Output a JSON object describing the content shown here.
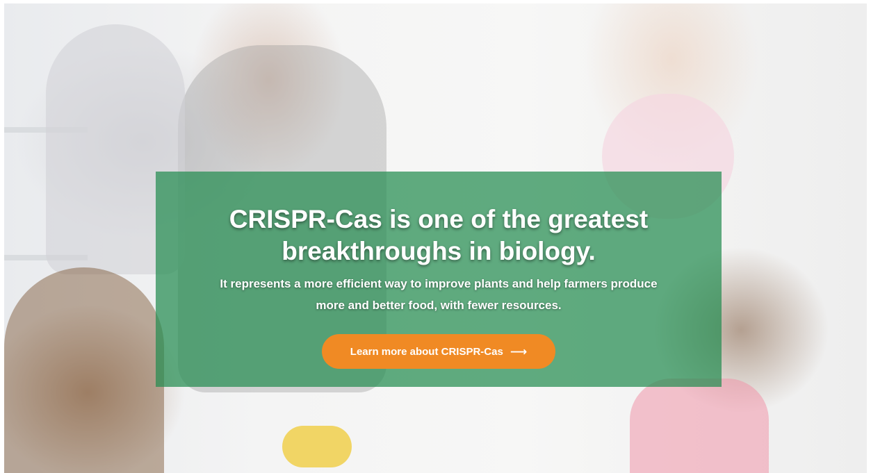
{
  "hero": {
    "headline": "CRISPR-Cas is one of the greatest breakthroughs in biology.",
    "subtext": "It represents a more efficient way to improve plants and help farmers produce more and better food, with fewer resources.",
    "cta_label": "Learn more about CRISPR-Cas",
    "cta_icon": "arrow-right-icon"
  },
  "colors": {
    "overlay": "#248c50",
    "cta": "#f08a24",
    "text": "#ffffff"
  }
}
